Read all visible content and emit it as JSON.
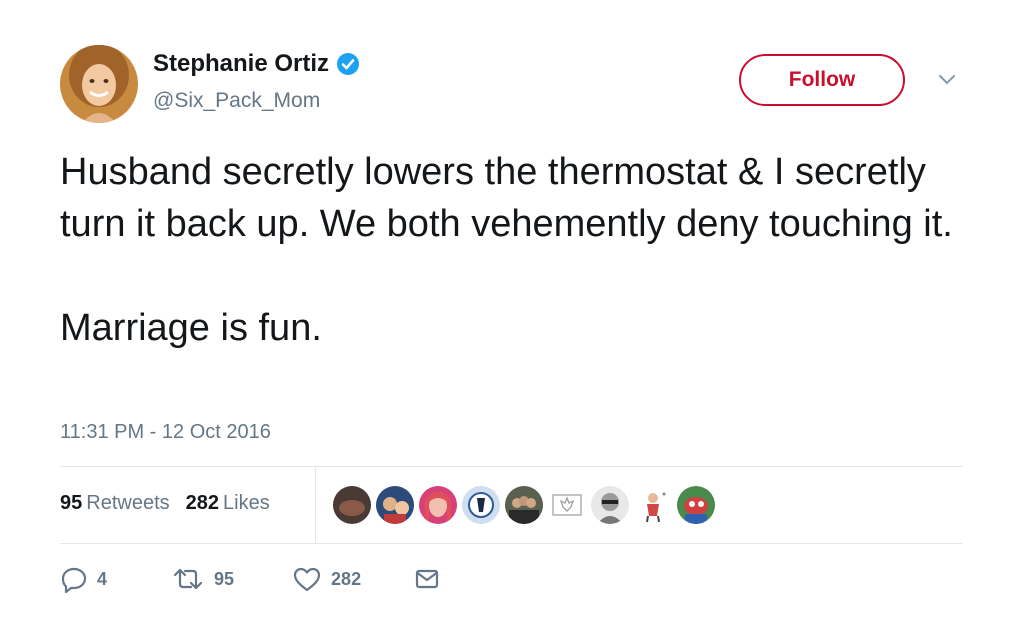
{
  "user": {
    "display_name": "Stephanie Ortiz",
    "handle": "@Six_Pack_Mom",
    "verified": true,
    "avatar_icon": "profile-photo"
  },
  "follow_label": "Follow",
  "tweet": {
    "paragraphs": [
      "Husband secretly lowers the thermostat & I secretly turn it back up. We both vehemently deny touching it.",
      "Marriage is fun."
    ],
    "timestamp": "11:31 PM - 12 Oct 2016"
  },
  "stats": {
    "retweets_count": "95",
    "retweets_label": "Retweets",
    "likes_count": "282",
    "likes_label": "Likes"
  },
  "likers_count_shown": 9,
  "actions": {
    "reply_count": "4",
    "retweet_count": "95",
    "like_count": "282"
  },
  "colors": {
    "follow_accent": "#c8102e",
    "verified_blue": "#1da1f2",
    "secondary_text": "#657786"
  }
}
